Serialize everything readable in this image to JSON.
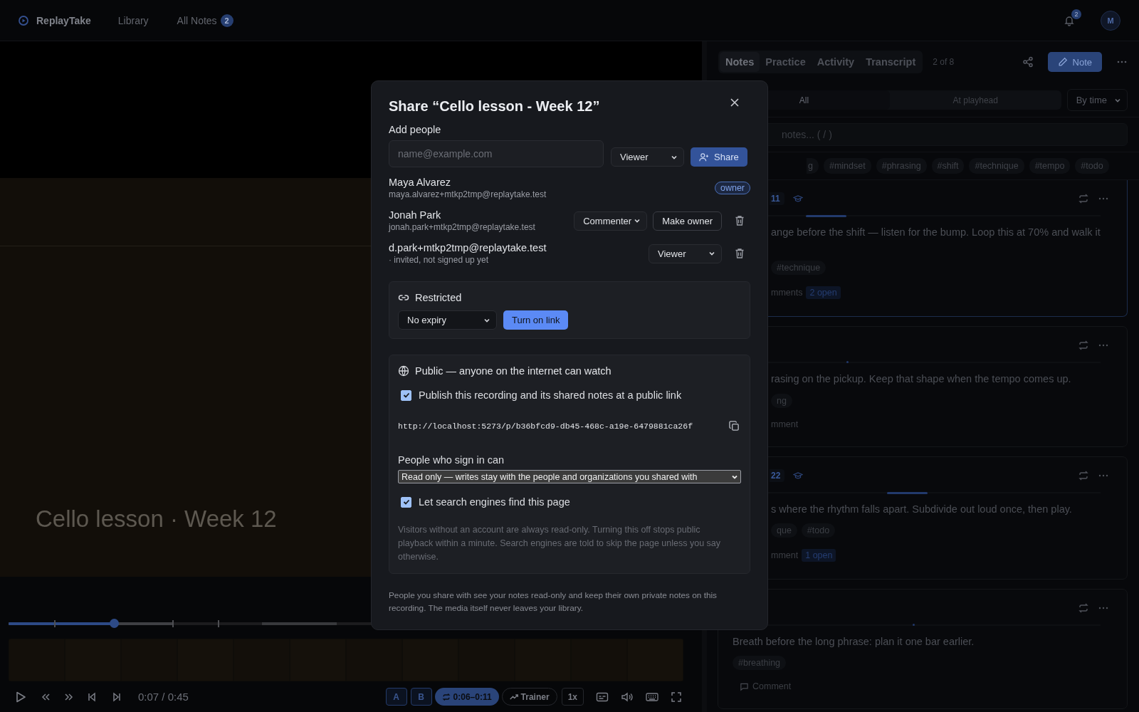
{
  "top_bar": {
    "app_name": "ReplayTake",
    "nav": [
      {
        "label": "Library"
      },
      {
        "label": "All Notes",
        "badge": "2"
      }
    ],
    "notifications_badge": "2",
    "avatar": "M"
  },
  "player": {
    "title": "Cello lesson · Week 12",
    "progress": {
      "level": 0.156
    },
    "time": "0:07 / 0:45",
    "loop_a": "A",
    "loop_b": "B",
    "loop_range": "0:06–0:11",
    "trainer": "Trainer",
    "speed": "1x"
  },
  "panel": {
    "tabs": [
      {
        "label": "Notes",
        "selected": true
      },
      {
        "label": "Practice",
        "selected": false
      },
      {
        "label": "Activity",
        "selected": false
      },
      {
        "label": "Transcript",
        "selected": false
      }
    ],
    "counter": "2 of 8",
    "note_button": "Note",
    "filters": [
      {
        "label": "All",
        "selected": true
      },
      {
        "label": "At playhead",
        "selected": false
      }
    ],
    "sort": "By time",
    "search": {
      "placeholder": "notes... ( / )"
    },
    "tags": [
      "g",
      "#mindset",
      "#phrasing",
      "#shift",
      "#technique",
      "#tempo",
      "#todo"
    ],
    "notes": [
      {
        "time": "11",
        "practice": true,
        "selected": true,
        "kind": "range",
        "text": "ange before the shift — listen for the bump. Loop this at 70% and walk it",
        "tags": [
          "#technique"
        ],
        "comments": "mments",
        "open": "2 open"
      },
      {
        "selected": false,
        "kind": "point",
        "text": "rasing on the pickup. Keep that shape when the tempo comes up.",
        "tags": [
          "ng"
        ],
        "comments": "mment"
      },
      {
        "time": "22",
        "practice": true,
        "selected": false,
        "kind": "range",
        "text": "s where the rhythm falls apart. Subdivide out loud once, then play.",
        "tags": [
          "que",
          "#todo"
        ],
        "comments": "mment",
        "open": "1 open"
      },
      {
        "selected": false,
        "kind": "point",
        "text": "Breath before the long phrase: plan it one bar earlier.",
        "tags": [
          "#breathing"
        ],
        "comments": "Comment",
        "comment_icon": true
      }
    ]
  },
  "dialog": {
    "title": "Share “Cello lesson - Week 12”",
    "add_label": "Add people",
    "email": {
      "placeholder": "name@example.com"
    },
    "role": "Viewer",
    "share_button": "Share",
    "people": [
      {
        "kind": "owner",
        "name": "Maya Alvarez",
        "detail": "maya.alvarez+mtkp2tmp@replaytake.test",
        "badge": "owner"
      },
      {
        "kind": "member",
        "name": "Jonah Park",
        "detail": "jonah.park+mtkp2tmp@replaytake.test",
        "role": "Commenter",
        "action": "Make owner"
      },
      {
        "kind": "invite",
        "name": "d.park+mtkp2tmp@replaytake.test",
        "detail": "· invited, not signed up yet",
        "role": "Viewer"
      }
    ],
    "link": {
      "title": "Restricted",
      "expiry": "No expiry",
      "button": "Turn on link"
    },
    "public": {
      "title": "Public — anyone on the internet can watch",
      "publish": {
        "label": "Publish this recording and its shared notes at a public link",
        "checked": true
      },
      "url": "http://localhost:5273/p/b36bfcd9-db45-468c-a19e-6479881ca26f",
      "signin_label": "People who sign in can",
      "signin_value": "Read only — writes stay with the people and organizations you shared with",
      "search": {
        "label": "Let search engines find this page",
        "checked": true
      },
      "note": "Visitors without an account are always read-only. Turning this off stops public playback within a minute. Search engines are told to skip the page unless you say otherwise."
    },
    "footer": "People you share with see your notes read-only and keep their own private notes on this recording. The media itself never leaves your library."
  }
}
